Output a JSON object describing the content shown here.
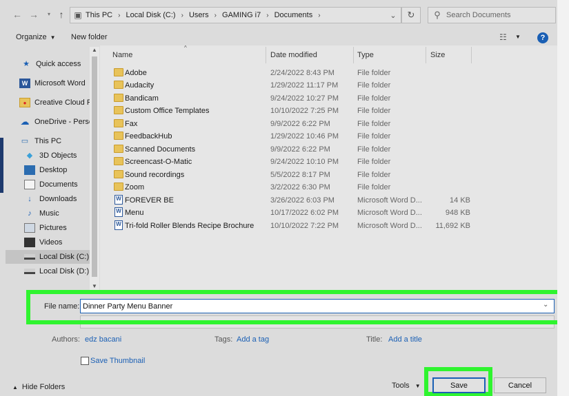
{
  "address_bar": {
    "crumbs": [
      "This PC",
      "Local Disk (C:)",
      "Users",
      "GAMING i7",
      "Documents"
    ],
    "separator": "›",
    "dropdown_icon": "chevron-down-icon",
    "refresh_icon": "refresh-icon"
  },
  "search": {
    "placeholder": "Search Documents",
    "icon": "search-icon"
  },
  "toolbar": {
    "organize": "Organize",
    "new_folder": "New folder"
  },
  "nav": {
    "items": [
      {
        "label": "Quick access",
        "icon": "star-icon"
      },
      {
        "label": "Microsoft Word",
        "icon": "word-icon"
      },
      {
        "label": "Creative Cloud Fil",
        "icon": "creative-cloud-icon"
      },
      {
        "label": "OneDrive - Person",
        "icon": "onedrive-icon"
      },
      {
        "label": "This PC",
        "icon": "computer-icon"
      },
      {
        "label": "3D Objects",
        "icon": "cube-icon"
      },
      {
        "label": "Desktop",
        "icon": "desktop-icon"
      },
      {
        "label": "Documents",
        "icon": "documents-icon"
      },
      {
        "label": "Downloads",
        "icon": "download-icon"
      },
      {
        "label": "Music",
        "icon": "music-icon"
      },
      {
        "label": "Pictures",
        "icon": "pictures-icon"
      },
      {
        "label": "Videos",
        "icon": "videos-icon"
      },
      {
        "label": "Local Disk (C:)",
        "icon": "drive-icon",
        "selected": true
      },
      {
        "label": "Local Disk (D:)",
        "icon": "drive-icon"
      }
    ]
  },
  "columns": {
    "name": "Name",
    "date": "Date modified",
    "type": "Type",
    "size": "Size"
  },
  "files": [
    {
      "name": "Adobe",
      "date": "2/24/2022 8:43 PM",
      "type": "File folder",
      "size": "",
      "kind": "folder"
    },
    {
      "name": "Audacity",
      "date": "1/29/2022 11:17 PM",
      "type": "File folder",
      "size": "",
      "kind": "folder"
    },
    {
      "name": "Bandicam",
      "date": "9/24/2022 10:27 PM",
      "type": "File folder",
      "size": "",
      "kind": "folder"
    },
    {
      "name": "Custom Office Templates",
      "date": "10/10/2022 7:25 PM",
      "type": "File folder",
      "size": "",
      "kind": "folder"
    },
    {
      "name": "Fax",
      "date": "9/9/2022 6:22 PM",
      "type": "File folder",
      "size": "",
      "kind": "folder"
    },
    {
      "name": "FeedbackHub",
      "date": "1/29/2022 10:46 PM",
      "type": "File folder",
      "size": "",
      "kind": "folder"
    },
    {
      "name": "Scanned Documents",
      "date": "9/9/2022 6:22 PM",
      "type": "File folder",
      "size": "",
      "kind": "folder"
    },
    {
      "name": "Screencast-O-Matic",
      "date": "9/24/2022 10:10 PM",
      "type": "File folder",
      "size": "",
      "kind": "folder"
    },
    {
      "name": "Sound recordings",
      "date": "5/5/2022 8:17 PM",
      "type": "File folder",
      "size": "",
      "kind": "folder"
    },
    {
      "name": "Zoom",
      "date": "3/2/2022 6:30 PM",
      "type": "File folder",
      "size": "",
      "kind": "folder"
    },
    {
      "name": "FOREVER BE",
      "date": "3/26/2022 6:03 PM",
      "type": "Microsoft Word D...",
      "size": "14 KB",
      "kind": "word"
    },
    {
      "name": "Menu",
      "date": "10/17/2022 6:02 PM",
      "type": "Microsoft Word D...",
      "size": "948 KB",
      "kind": "word"
    },
    {
      "name": "Tri-fold Roller Blends Recipe Brochure",
      "date": "10/10/2022 7:22 PM",
      "type": "Microsoft Word D...",
      "size": "11,692 KB",
      "kind": "word"
    }
  ],
  "save_form": {
    "file_name_label": "File name:",
    "file_name_value": "Dinner Party Menu Banner",
    "authors_label": "Authors:",
    "authors_value": "edz bacani",
    "tags_label": "Tags:",
    "tags_value": "Add a tag",
    "title_label": "Title:",
    "title_value": "Add a title",
    "thumbnail_label": "Save Thumbnail"
  },
  "footer": {
    "hide_folders": "Hide Folders",
    "tools": "Tools",
    "save": "Save",
    "cancel": "Cancel"
  },
  "colors": {
    "highlight": "#2ff42f",
    "accent": "#1a5fb4",
    "folder": "#e8c35a",
    "word": "#2b579a"
  }
}
